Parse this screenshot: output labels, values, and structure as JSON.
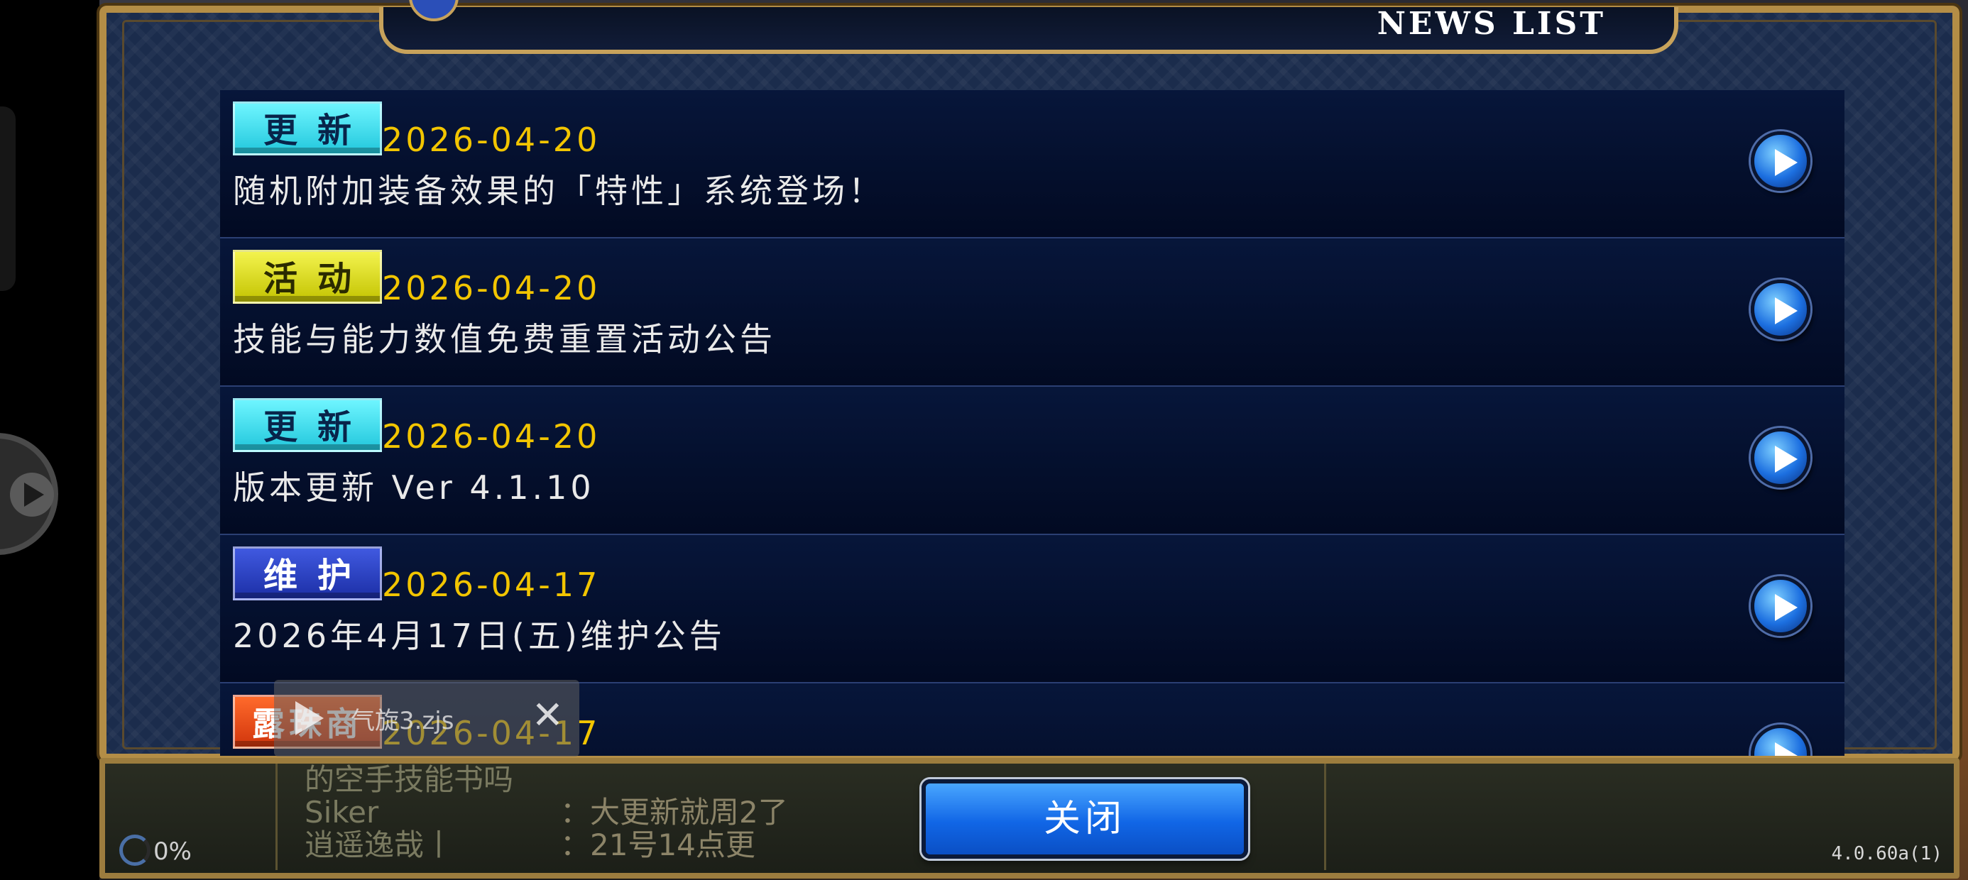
{
  "window": {
    "title": "NEWS LIST"
  },
  "news": {
    "items": [
      {
        "tag": "更新",
        "tag_type": "update",
        "date": "2026-04-20",
        "title": "随机附加装备效果的「特性」系统登场！"
      },
      {
        "tag": "活动",
        "tag_type": "event",
        "date": "2026-04-20",
        "title": "技能与能力数值免费重置活动公告"
      },
      {
        "tag": "更新",
        "tag_type": "update",
        "date": "2026-04-20",
        "title": "版本更新 Ver 4.1.10"
      },
      {
        "tag": "维护",
        "tag_type": "maintenance",
        "date": "2026-04-17",
        "title": "2026年4月17日(五)维护公告"
      },
      {
        "tag": "露珠商店",
        "tag_type": "shop",
        "date": "2026-04-17",
        "title": ""
      }
    ]
  },
  "toast": {
    "text": "气旋3.zjs",
    "close": "✕"
  },
  "chat": {
    "lines": [
      {
        "name": "的空手技能书吗",
        "message": ""
      },
      {
        "name": "Siker",
        "message": "：大更新就周2了"
      },
      {
        "name": "逍遥逸哉丨",
        "message": "：21号14点更"
      }
    ]
  },
  "bottom": {
    "close_label": "关闭",
    "progress": "0%",
    "version": "4.0.60a(1)"
  },
  "colors": {
    "date": "#f2c500",
    "update_tag": "#22c7dc",
    "event_tag": "#c3c301",
    "maintenance_tag": "#1c2fa6",
    "shop_tag": "#d1350c",
    "close_button": "#1166e6"
  }
}
